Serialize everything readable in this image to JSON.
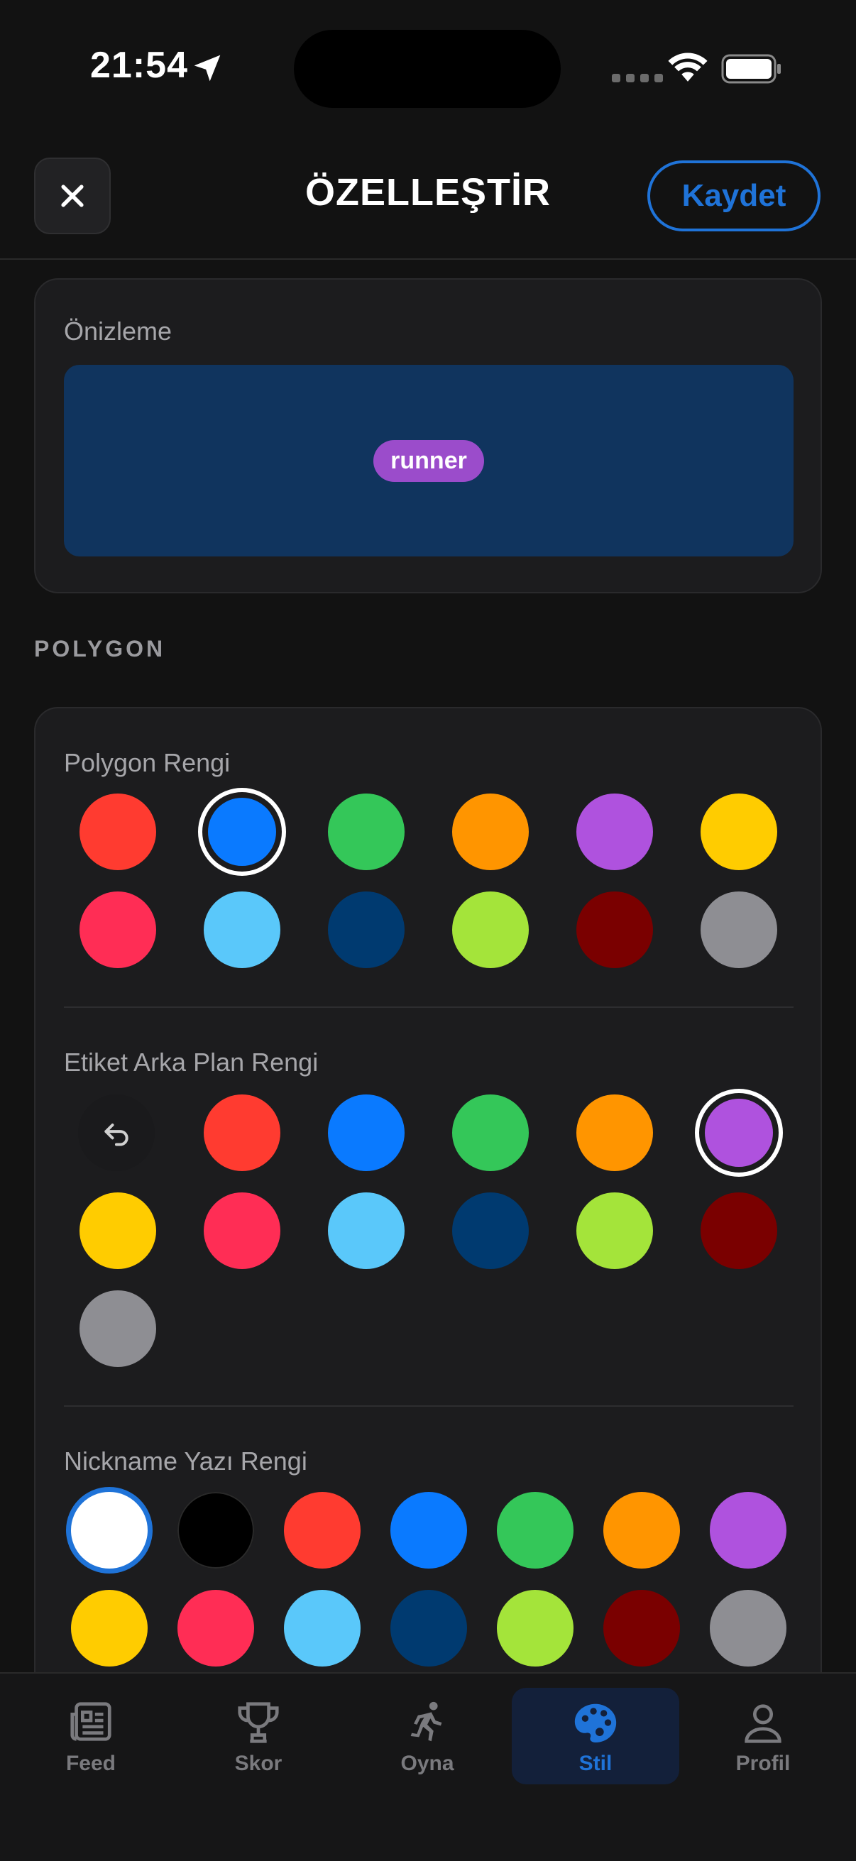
{
  "status_bar": {
    "time": "21:54"
  },
  "header": {
    "title": "ÖZELLEŞTİR",
    "save_label": "Kaydet"
  },
  "preview": {
    "label": "Önizleme",
    "tag_text": "runner",
    "background": "#10345E",
    "tag_color": "#9B4CCB"
  },
  "section_polygon": {
    "heading": "POLYGON"
  },
  "polygon_color": {
    "label": "Polygon Rengi",
    "selected": "#0A7AFF",
    "swatches": [
      "#FF3B30",
      "#0A7AFF",
      "#34C759",
      "#FF9500",
      "#AF52DE",
      "#FFCC00",
      "#FF2D55",
      "#5AC8FA",
      "#003A70",
      "#A4E43A",
      "#7A0000",
      "#8E8E93"
    ]
  },
  "label_bg_color": {
    "label": "Etiket Arka Plan Rengi",
    "reset_icon": "undo-icon",
    "selected": "#AF52DE",
    "swatches": [
      "#FF3B30",
      "#0A7AFF",
      "#34C759",
      "#FF9500",
      "#AF52DE",
      "#FFCC00",
      "#FF2D55",
      "#5AC8FA",
      "#003A70",
      "#A4E43A",
      "#7A0000",
      "#8E8E93"
    ]
  },
  "nickname_color": {
    "label": "Nickname Yazı Rengi",
    "selected": "#FFFFFF",
    "swatches": [
      "#FFFFFF",
      "#000000",
      "#FF3B30",
      "#0A7AFF",
      "#34C759",
      "#FF9500",
      "#AF52DE",
      "#FFCC00",
      "#FF2D55",
      "#5AC8FA",
      "#003A70",
      "#A4E43A",
      "#7A0000",
      "#8E8E93"
    ]
  },
  "tabs": [
    {
      "label": "Feed",
      "icon": "newspaper-icon"
    },
    {
      "label": "Skor",
      "icon": "trophy-icon"
    },
    {
      "label": "Oyna",
      "icon": "running-person-icon"
    },
    {
      "label": "Stil",
      "icon": "palette-icon",
      "active": true
    },
    {
      "label": "Profil",
      "icon": "person-icon"
    }
  ],
  "accent_color": "#1F73D8"
}
